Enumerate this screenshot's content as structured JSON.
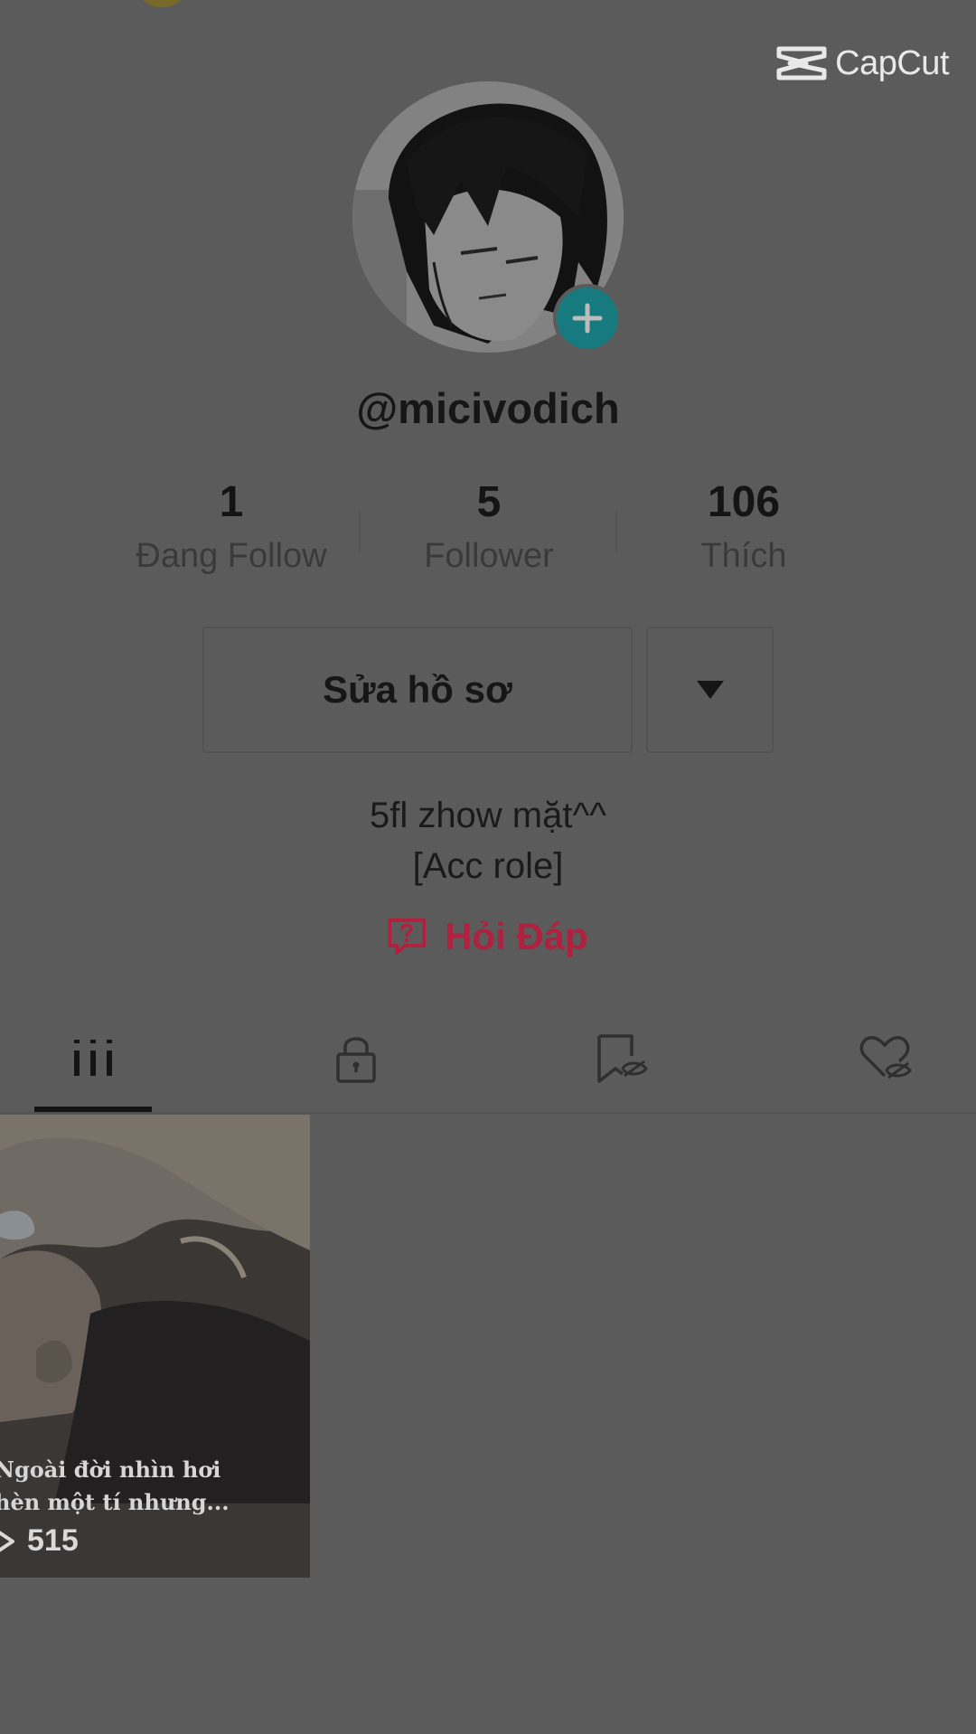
{
  "watermark": {
    "brand": "CapCut",
    "icon": "capcut-logo-icon"
  },
  "profile": {
    "username": "@micivodich",
    "avatar_icon": "avatar-image",
    "add_icon": "plus-icon",
    "accent_color": "#177a7e"
  },
  "stats": [
    {
      "value": "1",
      "label": "Đang Follow"
    },
    {
      "value": "5",
      "label": "Follower"
    },
    {
      "value": "106",
      "label": "Thích"
    }
  ],
  "actions": {
    "edit_label": "Sửa hồ sơ",
    "more_icon": "triangle-down-icon"
  },
  "bio": {
    "line1": "5fl zhow mặt^^",
    "line2": "[Acc role]"
  },
  "qa": {
    "label": "Hỏi Đáp",
    "icon": "question-bubble-icon",
    "color": "#b0213f"
  },
  "tabs": [
    {
      "icon": "grid-icon",
      "active": true
    },
    {
      "icon": "lock-icon",
      "active": false
    },
    {
      "icon": "bookmark-hidden-icon",
      "active": false
    },
    {
      "icon": "heart-hidden-icon",
      "active": false
    }
  ],
  "videos": [
    {
      "caption_line1": "Ngoài đời nhìn hơi",
      "caption_line2": "hèn một tí nhưng...",
      "views": "515",
      "play_icon": "play-icon"
    }
  ]
}
